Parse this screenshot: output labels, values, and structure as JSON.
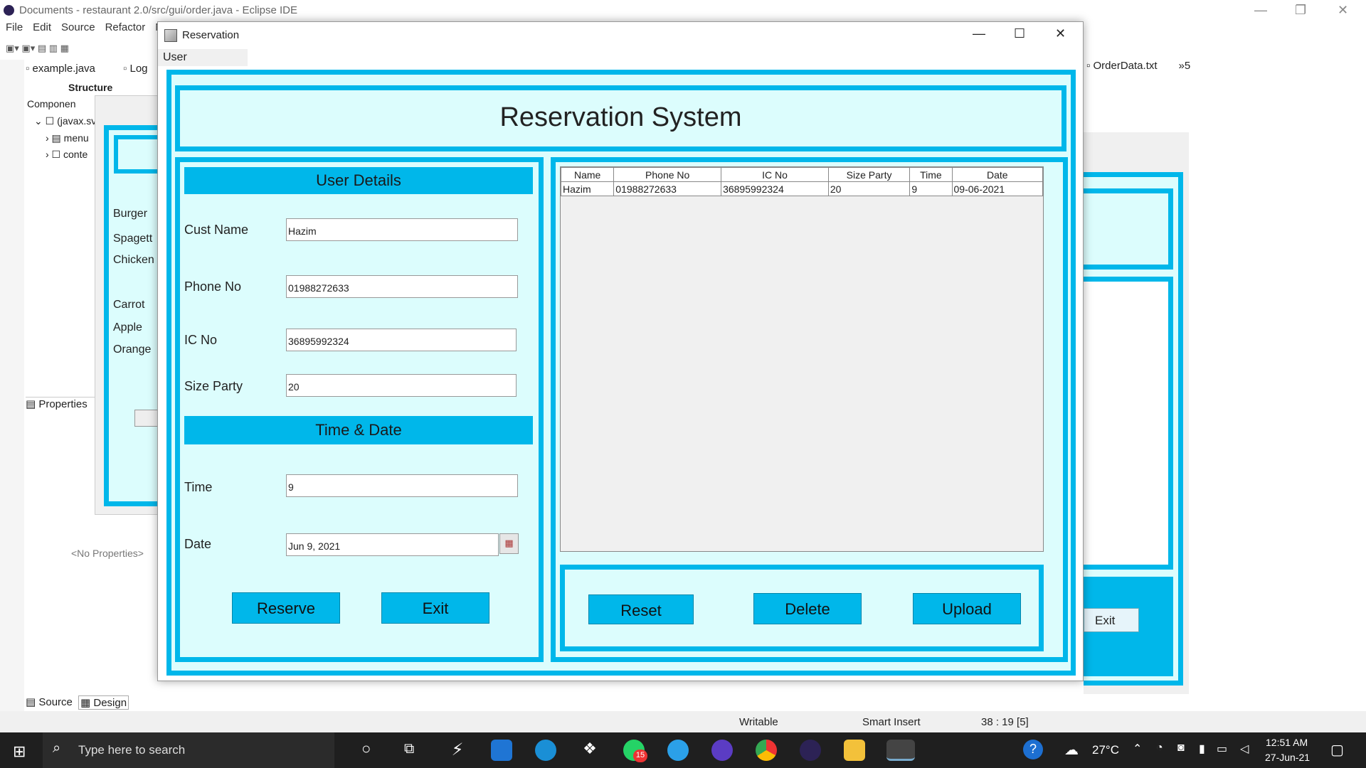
{
  "ide": {
    "title": "Documents - restaurant 2.0/src/gui/order.java - Eclipse IDE",
    "menu": [
      "File",
      "Edit",
      "Source",
      "Refactor",
      "N"
    ],
    "tabs": [
      "example.java",
      "Log"
    ],
    "right_tab": "OrderData.txt",
    "right_tab_extra": "»5",
    "structure_label": "Structure",
    "components_label": "Componen",
    "tree": [
      "(javax.sv",
      "menu",
      "conte"
    ],
    "menu_items": [
      "Burger",
      "Spagett",
      "Chicken",
      "Carrot",
      "Apple",
      "Orange"
    ],
    "properties_label": "Properties",
    "no_properties": "<No Properties>",
    "bg_exit": "Exit",
    "source_tab": "Source",
    "design_tab": "Design",
    "status": {
      "writable": "Writable",
      "insert": "Smart Insert",
      "pos": "38 : 19 [5]"
    }
  },
  "dialog": {
    "title": "Reservation",
    "menu_user": "User",
    "header": "Reservation System",
    "user_details": "User Details",
    "time_date": "Time & Date",
    "fields": {
      "cust_name_label": "Cust Name",
      "cust_name": "Hazim",
      "phone_label": "Phone No",
      "phone": "01988272633",
      "ic_label": "IC No",
      "ic": "36895992324",
      "size_label": "Size Party",
      "size": "20",
      "time_label": "Time",
      "time": "9",
      "date_label": "Date",
      "date": "Jun 9, 2021"
    },
    "buttons": {
      "reserve": "Reserve",
      "exit": "Exit",
      "reset": "Reset",
      "delete": "Delete",
      "upload": "Upload"
    },
    "table": {
      "columns": [
        "Name",
        "Phone No",
        "IC No",
        "Size Party",
        "Time",
        "Date"
      ],
      "rows": [
        [
          "Hazim",
          "01988272633",
          "36895992324",
          "20",
          "9",
          "09-06-2021"
        ]
      ]
    }
  },
  "taskbar": {
    "search": "Type here to search",
    "whatsapp_badge": "15",
    "weather": "27°C",
    "time": "12:51 AM",
    "date": "27-Jun-21"
  }
}
